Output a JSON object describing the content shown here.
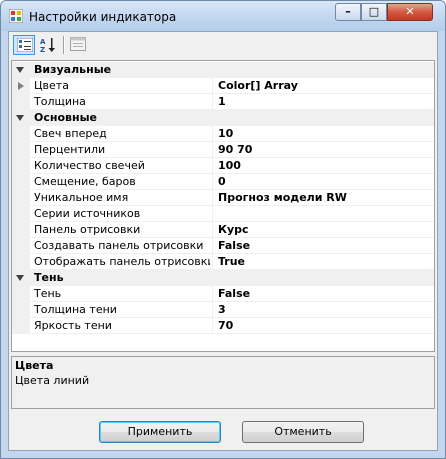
{
  "window": {
    "title": "Настройки индикатора"
  },
  "title_buttons": {
    "minimize": "–",
    "maximize": "□",
    "close": "✕"
  },
  "toolbar": {
    "categorized_icon": "categorized-view-icon",
    "alphabetical_icon": "alphabetical-sort-icon",
    "pages_icon": "property-pages-icon"
  },
  "grid": {
    "categories": [
      {
        "label": "Визуальные",
        "props": [
          {
            "name": "Цвета",
            "value": "Color[] Array",
            "expandable": true
          },
          {
            "name": "Толщина",
            "value": "1"
          }
        ]
      },
      {
        "label": "Основные",
        "props": [
          {
            "name": "Свеч вперед",
            "value": "10"
          },
          {
            "name": "Перцентили",
            "value": "90 70"
          },
          {
            "name": "Количество свечей",
            "value": "100"
          },
          {
            "name": "Смещение, баров",
            "value": "0"
          },
          {
            "name": "Уникальное имя",
            "value": "Прогноз модели RW"
          },
          {
            "name": "Серии источников",
            "value": ""
          },
          {
            "name": "Панель отрисовки",
            "value": "Курс"
          },
          {
            "name": "Создавать панель отрисовки",
            "value": "False"
          },
          {
            "name": "Отображать панель отрисовки",
            "value": "True"
          }
        ]
      },
      {
        "label": "Тень",
        "props": [
          {
            "name": "Тень",
            "value": "False"
          },
          {
            "name": "Толщина тени",
            "value": "3"
          },
          {
            "name": "Яркость тени",
            "value": "70"
          }
        ]
      }
    ]
  },
  "description": {
    "title": "Цвета",
    "text": "Цвета линий"
  },
  "buttons": {
    "apply": "Применить",
    "cancel": "Отменить"
  }
}
